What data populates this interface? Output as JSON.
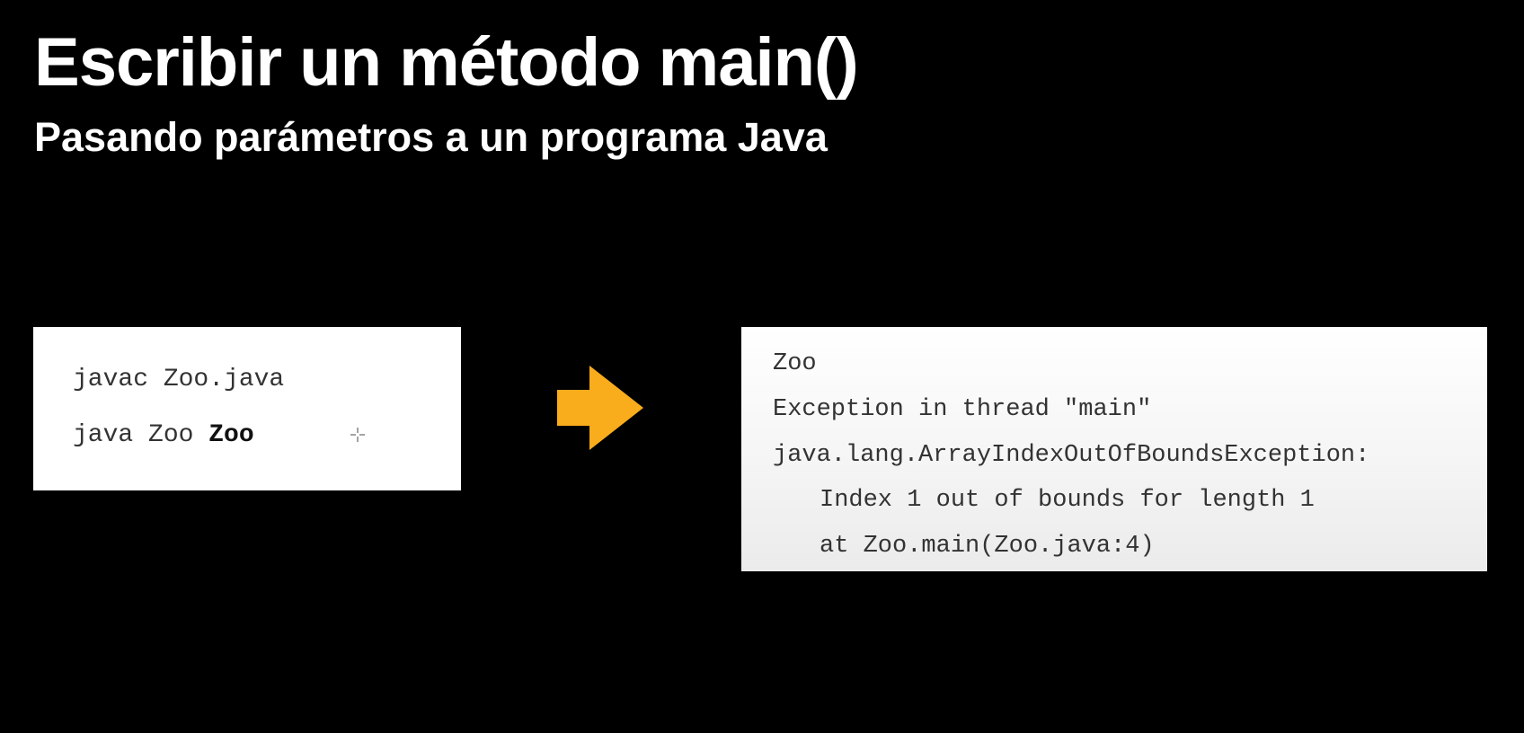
{
  "slide": {
    "title": "Escribir un método main()",
    "subtitle": "Pasando parámetros a un programa Java"
  },
  "command_panel": {
    "compile_line": "javac Zoo.java",
    "run_command": "java Zoo",
    "run_argument": "Zoo"
  },
  "output_panel": {
    "lines": [
      "Zoo",
      "Exception in thread \"main\"",
      "java.lang.ArrayIndexOutOfBoundsException:",
      "Index 1 out of bounds for length 1",
      "at Zoo.main(Zoo.java:4)"
    ]
  },
  "icons": {
    "arrow": "right-arrow-icon",
    "cursor": "crosshair-cursor-icon"
  },
  "colors": {
    "background": "#000000",
    "title_text": "#ffffff",
    "panel_background": "#ffffff",
    "code_text": "#333333",
    "arrow": "#F9AC1C"
  }
}
